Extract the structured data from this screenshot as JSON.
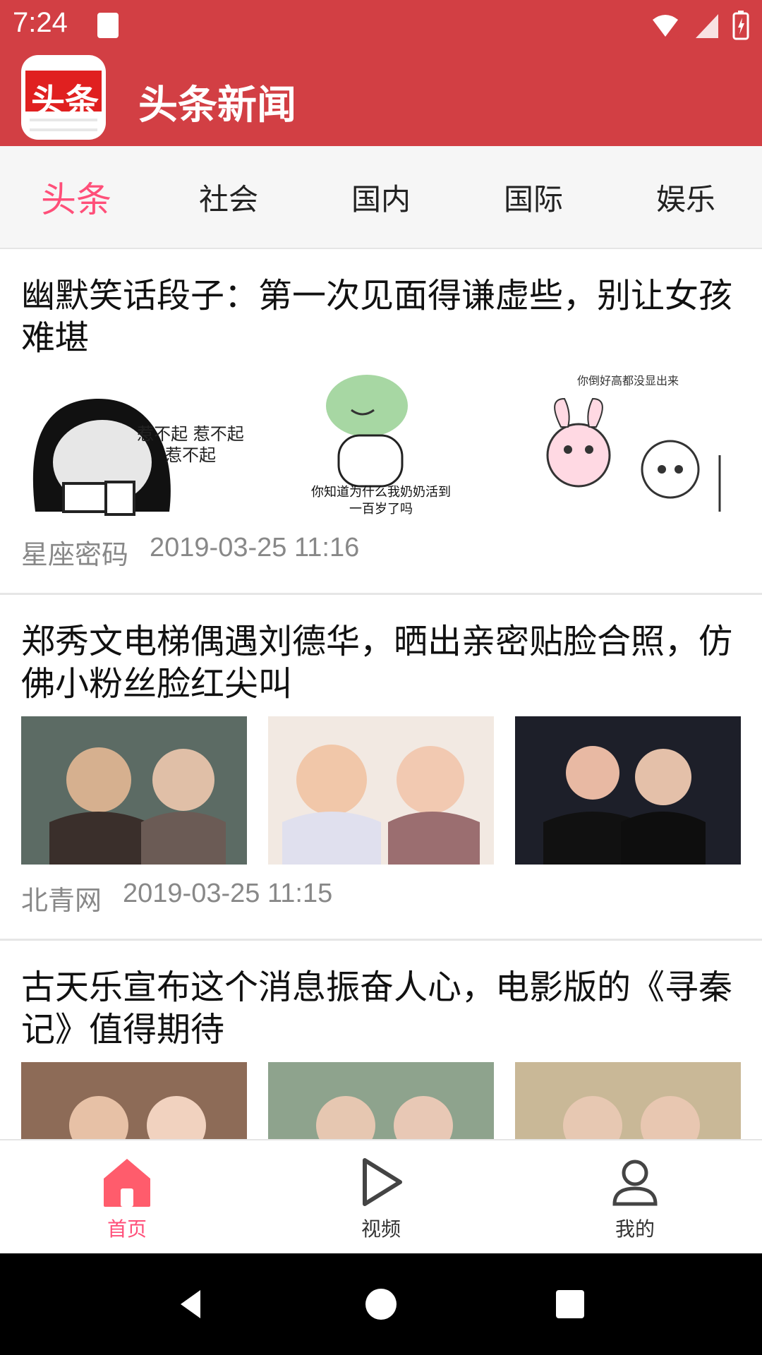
{
  "status": {
    "time": "7:24"
  },
  "app": {
    "title": "头条新闻",
    "logo_text": "头条"
  },
  "tabs": [
    {
      "label": "头条",
      "active": true
    },
    {
      "label": "社会"
    },
    {
      "label": "国内"
    },
    {
      "label": "国际"
    },
    {
      "label": "娱乐"
    }
  ],
  "feed": [
    {
      "title": "幽默笑话段子：第一次见面得谦虚些，别让女孩难堪",
      "source": "星座密码",
      "time": "2019-03-25 11:16",
      "images": [
        {
          "caption": "惹不起\n惹不起"
        },
        {
          "caption": "你知道为什么我奶奶活到一百岁了吗"
        },
        {
          "caption": "你倒好高都没显出来"
        }
      ]
    },
    {
      "title": "郑秀文电梯偶遇刘德华，晒出亲密贴脸合照，仿佛小粉丝脸红尖叫",
      "source": "北青网",
      "time": "2019-03-25 11:15",
      "images": [
        {},
        {},
        {}
      ]
    },
    {
      "title": "古天乐宣布这个消息振奋人心，电影版的《寻秦记》值得期待",
      "source": "",
      "time": "",
      "images": [
        {},
        {},
        {}
      ]
    }
  ],
  "bottom_nav": [
    {
      "label": "首页",
      "active": true,
      "icon": "home-icon"
    },
    {
      "label": "视频",
      "icon": "play-icon"
    },
    {
      "label": "我的",
      "icon": "profile-icon"
    }
  ],
  "system_nav": [
    "back",
    "home",
    "recents"
  ]
}
